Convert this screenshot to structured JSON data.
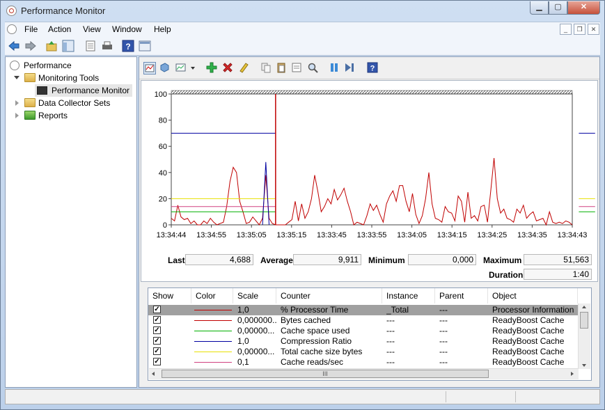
{
  "window": {
    "title": "Performance Monitor",
    "min": "▁",
    "max": "▢",
    "close": "✕"
  },
  "menu": [
    "File",
    "Action",
    "View",
    "Window",
    "Help"
  ],
  "tree": {
    "root": "Performance",
    "monitoring_tools": "Monitoring Tools",
    "performance_monitor": "Performance Monitor",
    "data_collector_sets": "Data Collector Sets",
    "reports": "Reports"
  },
  "stats": {
    "last_label": "Last",
    "last": "4,688",
    "average_label": "Average",
    "average": "9,911",
    "minimum_label": "Minimum",
    "minimum": "0,000",
    "maximum_label": "Maximum",
    "maximum": "51,563",
    "duration_label": "Duration",
    "duration": "1:40"
  },
  "table": {
    "headers": [
      "Show",
      "Color",
      "Scale",
      "Counter",
      "Instance",
      "Parent",
      "Object"
    ],
    "rows": [
      {
        "show": "✓",
        "color": "#c00000",
        "scale": "1,0",
        "counter": "% Processor Time",
        "instance": "_Total",
        "parent": "---",
        "object": "Processor Information"
      },
      {
        "show": "✓",
        "color": "#c00000",
        "scale": "0,000000...",
        "counter": "Bytes cached",
        "instance": "---",
        "parent": "---",
        "object": "ReadyBoost Cache"
      },
      {
        "show": "✓",
        "color": "#00b000",
        "scale": "0,00000...",
        "counter": "Cache space used",
        "instance": "---",
        "parent": "---",
        "object": "ReadyBoost Cache"
      },
      {
        "show": "✓",
        "color": "#0000a0",
        "scale": "1,0",
        "counter": "Compression Ratio",
        "instance": "---",
        "parent": "---",
        "object": "ReadyBoost Cache"
      },
      {
        "show": "✓",
        "color": "#e8e000",
        "scale": "0,00000...",
        "counter": "Total cache size bytes",
        "instance": "---",
        "parent": "---",
        "object": "ReadyBoost Cache"
      },
      {
        "show": "✓",
        "color": "#d04080",
        "scale": "0,1",
        "counter": "Cache reads/sec",
        "instance": "---",
        "parent": "---",
        "object": "ReadyBoost Cache"
      }
    ],
    "hscroll_thumb": "III"
  },
  "colors": {
    "accent_window": "#c6d5e9",
    "cursor_line": "#c00000"
  },
  "chart_data": {
    "type": "line",
    "ylim": [
      0,
      100
    ],
    "yticks": [
      0,
      20,
      40,
      60,
      80,
      100
    ],
    "xticks": [
      "13:34:44",
      "13:34:55",
      "13:35:05",
      "13:35:15",
      "13:33:45",
      "13:33:55",
      "13:34:05",
      "13:34:15",
      "13:34:25",
      "13:34:35",
      "13:34:43"
    ],
    "grid": false,
    "cursor_at_sample": 32,
    "series": [
      {
        "color": "#c00000",
        "values": [
          5,
          3,
          15,
          6,
          4,
          5,
          1,
          3,
          0,
          0,
          3,
          1,
          5,
          2,
          0,
          1,
          2,
          14,
          33,
          44,
          40,
          18,
          10,
          1,
          2,
          6,
          3,
          0,
          5,
          38,
          5,
          1,
          0,
          0,
          0,
          0,
          2,
          4,
          18,
          3,
          16,
          5,
          10,
          20,
          38,
          25,
          10,
          14,
          20,
          16,
          27,
          19,
          23,
          28,
          18,
          10,
          0,
          2,
          1,
          0,
          7,
          16,
          11,
          15,
          8,
          2,
          16,
          22,
          26,
          18,
          30,
          30,
          18,
          10,
          24,
          8,
          1,
          7,
          20,
          40,
          16,
          5,
          4,
          2,
          14,
          10,
          9,
          3,
          22,
          18,
          2,
          25,
          5,
          7,
          3,
          14,
          15,
          2,
          26,
          51,
          20,
          9,
          12,
          5,
          4,
          2,
          12,
          9,
          15,
          5,
          8,
          10,
          3,
          4,
          5,
          0,
          10,
          2,
          1,
          2,
          1,
          3,
          2,
          0
        ]
      },
      {
        "color": "#0000a0",
        "values": [
          70,
          70,
          70,
          70,
          70,
          70,
          70,
          70,
          70,
          70,
          70,
          70,
          70,
          70,
          70,
          70,
          70,
          70,
          70,
          70,
          70,
          70,
          70,
          70,
          70,
          70,
          70,
          70,
          70,
          70,
          70,
          70,
          70,
          null,
          null,
          null,
          null,
          null,
          null,
          null,
          null,
          null,
          null,
          null,
          null,
          null,
          null,
          null,
          null,
          null,
          null,
          null,
          null,
          null,
          null,
          null,
          null,
          null,
          null,
          null,
          null,
          null,
          null,
          null,
          null,
          null,
          null,
          null,
          null,
          null,
          null,
          null,
          null,
          null,
          null,
          null,
          null,
          null,
          null,
          null,
          null,
          null,
          null,
          null,
          null,
          null,
          null,
          null,
          null,
          null,
          null,
          null,
          null,
          null,
          null,
          null,
          null,
          null,
          null,
          null,
          null,
          null,
          null,
          null,
          null,
          null,
          null,
          null,
          null,
          null,
          null,
          null,
          null,
          null,
          null,
          null,
          null,
          null,
          null,
          null,
          null,
          null,
          null,
          null,
          null,
          70,
          70,
          70,
          70,
          70,
          70
        ]
      },
      {
        "color": "#e8e000",
        "values": [
          20,
          20,
          20,
          20,
          20,
          20,
          20,
          20,
          20,
          20,
          20,
          20,
          20,
          20,
          20,
          20,
          20,
          20,
          20,
          20,
          20,
          20,
          20,
          20,
          20,
          20,
          20,
          20,
          20,
          20,
          20,
          20,
          20,
          null,
          null,
          null,
          null,
          null,
          null,
          null,
          null,
          null,
          null,
          null,
          null,
          null,
          null,
          null,
          null,
          null,
          null,
          null,
          null,
          null,
          null,
          null,
          null,
          null,
          null,
          null,
          null,
          null,
          null,
          null,
          null,
          null,
          null,
          null,
          null,
          null,
          null,
          null,
          null,
          null,
          null,
          null,
          null,
          null,
          null,
          null,
          null,
          null,
          null,
          null,
          null,
          null,
          null,
          null,
          null,
          null,
          null,
          null,
          null,
          null,
          null,
          null,
          null,
          null,
          null,
          null,
          null,
          null,
          null,
          null,
          null,
          null,
          null,
          null,
          null,
          null,
          null,
          null,
          null,
          null,
          null,
          null,
          null,
          null,
          null,
          null,
          null,
          null,
          null,
          null,
          null,
          20,
          20,
          20,
          20,
          20,
          20
        ]
      },
      {
        "color": "#00b000",
        "values": [
          10,
          10,
          10,
          10,
          10,
          10,
          10,
          10,
          10,
          10,
          10,
          10,
          10,
          10,
          10,
          10,
          10,
          10,
          10,
          10,
          10,
          10,
          10,
          10,
          10,
          10,
          10,
          10,
          10,
          10,
          10,
          10,
          10,
          null,
          null,
          null,
          null,
          null,
          null,
          null,
          null,
          null,
          null,
          null,
          null,
          null,
          null,
          null,
          null,
          null,
          null,
          null,
          null,
          null,
          null,
          null,
          null,
          null,
          null,
          null,
          null,
          null,
          null,
          null,
          null,
          null,
          null,
          null,
          null,
          null,
          null,
          null,
          null,
          null,
          null,
          null,
          null,
          null,
          null,
          null,
          null,
          null,
          null,
          null,
          null,
          null,
          null,
          null,
          null,
          null,
          null,
          null,
          null,
          null,
          null,
          null,
          null,
          null,
          null,
          null,
          null,
          null,
          null,
          null,
          null,
          null,
          null,
          null,
          null,
          null,
          null,
          null,
          null,
          null,
          null,
          null,
          null,
          null,
          null,
          null,
          null,
          null,
          null,
          null,
          null,
          10,
          10,
          10,
          10,
          10,
          10
        ]
      },
      {
        "color": "#d04080",
        "values": [
          14,
          14,
          14,
          14,
          14,
          14,
          14,
          14,
          14,
          14,
          14,
          14,
          14,
          14,
          14,
          14,
          14,
          14,
          14,
          14,
          14,
          14,
          14,
          14,
          14,
          14,
          14,
          14,
          14,
          14,
          14,
          14,
          14,
          null,
          null,
          null,
          null,
          null,
          null,
          null,
          null,
          null,
          null,
          null,
          null,
          null,
          null,
          null,
          null,
          null,
          null,
          null,
          null,
          null,
          null,
          null,
          null,
          null,
          null,
          null,
          null,
          null,
          null,
          null,
          null,
          null,
          null,
          null,
          null,
          null,
          null,
          null,
          null,
          null,
          null,
          null,
          null,
          null,
          null,
          null,
          null,
          null,
          null,
          null,
          null,
          null,
          null,
          null,
          null,
          null,
          null,
          null,
          null,
          null,
          null,
          null,
          null,
          null,
          null,
          null,
          null,
          null,
          null,
          null,
          null,
          null,
          null,
          null,
          null,
          null,
          null,
          null,
          null,
          null,
          null,
          null,
          null,
          null,
          null,
          null,
          null,
          null,
          null,
          null,
          null,
          14,
          14,
          14,
          14,
          14,
          14
        ]
      },
      {
        "color": "#0000a0",
        "values": [
          null,
          null,
          null,
          null,
          null,
          null,
          null,
          null,
          null,
          null,
          null,
          null,
          null,
          null,
          null,
          null,
          null,
          null,
          null,
          null,
          null,
          null,
          null,
          null,
          null,
          null,
          null,
          null,
          0,
          48,
          0
        ]
      }
    ]
  }
}
